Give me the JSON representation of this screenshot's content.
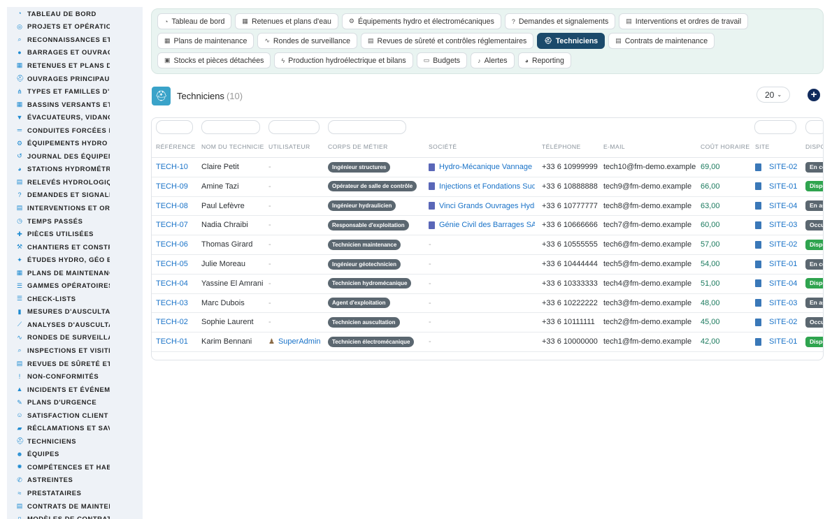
{
  "sidebar": {
    "items": [
      {
        "label": "TABLEAU DE BORD",
        "icon": "dashboard-icon"
      },
      {
        "label": "PROJETS ET OPÉRATIONS",
        "icon": "target-icon"
      },
      {
        "label": "RECONNAISSANCES ET VISITES",
        "icon": "search-icon"
      },
      {
        "label": "BARRAGES ET OUVRAGES",
        "icon": "location-pin-icon"
      },
      {
        "label": "RETENUES ET PLANS D'EAU",
        "icon": "building-icon"
      },
      {
        "label": "OUVRAGES PRINCIPAUX",
        "icon": "hard-hat-icon"
      },
      {
        "label": "TYPES ET FAMILLES D'OUVRAGES",
        "icon": "sitemap-icon"
      },
      {
        "label": "BASSINS VERSANTS ET AFFLUENTS",
        "icon": "grid-icon"
      },
      {
        "label": "ÉVACUATEURS, VIDANGES",
        "icon": "funnel-icon"
      },
      {
        "label": "CONDUITES FORCÉES ET GALERIES",
        "icon": "pipe-icon"
      },
      {
        "label": "ÉQUIPEMENTS HYDRO ET ÉLECTROMÉCANIQUES",
        "icon": "cogs-icon"
      },
      {
        "label": "JOURNAL DES ÉQUIPEMENTS",
        "icon": "history-icon"
      },
      {
        "label": "STATIONS HYDROMÉTRIQUES",
        "icon": "gauge-icon"
      },
      {
        "label": "RELEVÉS HYDROLOGIQUES",
        "icon": "clipboard-icon"
      },
      {
        "label": "DEMANDES ET SIGNALEMENTS",
        "icon": "question-circle-icon"
      },
      {
        "label": "INTERVENTIONS ET ORDRES DE TRAVAIL",
        "icon": "clipboard-check-icon"
      },
      {
        "label": "TEMPS PASSÉS",
        "icon": "clock-icon"
      },
      {
        "label": "PIÈCES UTILISÉES",
        "icon": "puzzle-icon"
      },
      {
        "label": "CHANTIERS ET CONSTRUCTIONS",
        "icon": "hammer-icon"
      },
      {
        "label": "ÉTUDES HYDRO, GÉO ET STRUCTURE",
        "icon": "compass-icon"
      },
      {
        "label": "PLANS DE MAINTENANCE",
        "icon": "calendar-icon"
      },
      {
        "label": "GAMMES OPÉRATOIRES",
        "icon": "tasks-icon"
      },
      {
        "label": "CHECK-LISTS",
        "icon": "list-icon"
      },
      {
        "label": "MESURES D'AUSCULTATION",
        "icon": "ruler-icon"
      },
      {
        "label": "ANALYSES D'AUSCULTATION",
        "icon": "chart-line-icon"
      },
      {
        "label": "RONDES DE SURVEILLANCE",
        "icon": "route-icon"
      },
      {
        "label": "INSPECTIONS ET VISITES",
        "icon": "search-document-icon"
      },
      {
        "label": "REVUES DE SÛRETÉ ET CONTRÔLES",
        "icon": "file-check-icon"
      },
      {
        "label": "NON-CONFORMITÉS",
        "icon": "exclamation-circle-icon"
      },
      {
        "label": "INCIDENTS ET ÉVÉNEMENTS",
        "icon": "warning-icon"
      },
      {
        "label": "PLANS D'URGENCE",
        "icon": "file-signature-icon"
      },
      {
        "label": "SATISFACTION CLIENT",
        "icon": "smile-icon"
      },
      {
        "label": "RÉCLAMATIONS ET SAV",
        "icon": "comment-icon"
      },
      {
        "label": "TECHNICIENS",
        "icon": "hard-hat-icon"
      },
      {
        "label": "ÉQUIPES",
        "icon": "users-icon"
      },
      {
        "label": "COMPÉTENCES ET HABILITATIONS",
        "icon": "certificate-icon"
      },
      {
        "label": "ASTREINTES",
        "icon": "phone-icon"
      },
      {
        "label": "PRESTATAIRES",
        "icon": "handshake-icon"
      },
      {
        "label": "CONTRATS DE MAINTENANCE",
        "icon": "file-contract-icon"
      },
      {
        "label": "MODÈLES DE CONTRATS",
        "icon": "file-icon"
      }
    ]
  },
  "tabs": [
    {
      "label": "Tableau de bord",
      "icon": "dashboard-icon",
      "glyph": "◔",
      "active": false
    },
    {
      "label": "Retenues et plans d'eau",
      "icon": "building-icon",
      "glyph": "▦",
      "active": false
    },
    {
      "label": "Équipements hydro et électromécaniques",
      "icon": "cogs-icon",
      "glyph": "⚙",
      "active": false
    },
    {
      "label": "Demandes et signalements",
      "icon": "question-circle-icon",
      "glyph": "?",
      "active": false
    },
    {
      "label": "Interventions et ordres de travail",
      "icon": "clipboard-check-icon",
      "glyph": "▤",
      "active": false
    },
    {
      "label": "Plans de maintenance",
      "icon": "calendar-icon",
      "glyph": "▦",
      "active": false
    },
    {
      "label": "Rondes de surveillance",
      "icon": "route-icon",
      "glyph": "∿",
      "active": false
    },
    {
      "label": "Revues de sûreté et contrôles réglementaires",
      "icon": "file-check-icon",
      "glyph": "▤",
      "active": false
    },
    {
      "label": "Techniciens",
      "icon": "hard-hat-icon",
      "glyph": "⛑",
      "active": true
    },
    {
      "label": "Contrats de maintenance",
      "icon": "file-contract-icon",
      "glyph": "▤",
      "active": false
    },
    {
      "label": "Stocks et pièces détachées",
      "icon": "boxes-icon",
      "glyph": "▣",
      "active": false
    },
    {
      "label": "Production hydroélectrique et bilans",
      "icon": "bolt-icon",
      "glyph": "ϟ",
      "active": false
    },
    {
      "label": "Budgets",
      "icon": "money-icon",
      "glyph": "▭",
      "active": false
    },
    {
      "label": "Alertes",
      "icon": "bell-icon",
      "glyph": "♪",
      "active": false
    },
    {
      "label": "Reporting",
      "icon": "pie-chart-icon",
      "glyph": "◕",
      "active": false
    }
  ],
  "page": {
    "title": "Techniciens",
    "count": "(10)",
    "per_page": "20"
  },
  "table": {
    "headers": [
      "RÉFÉRENCE",
      "NOM DU TECHNICIEN",
      "UTILISATEUR",
      "CORPS DE MÉTIER",
      "SOCIÉTÉ",
      "TÉLÉPHONE",
      "E-MAIL",
      "COÛT HORAIRE",
      "SITE",
      "DISPONIBILITÉ"
    ],
    "rows": [
      {
        "ref": "TECH-10",
        "name": "Claire Petit",
        "user": "-",
        "metier": "Ingénieur structures",
        "societe": "Hydro-Mécanique Vannage",
        "tel": "+33 6 10999999",
        "email": "tech10@fm-demo.example",
        "cout": "69,00",
        "site": "SITE-02",
        "dispo": "En cours",
        "dispo_color": "#5b6770"
      },
      {
        "ref": "TECH-09",
        "name": "Amine Tazi",
        "user": "-",
        "metier": "Opérateur de salle de contrôle",
        "societe": "Injections et Fondations Sud",
        "tel": "+33 6 10888888",
        "email": "tech9@fm-demo.example",
        "cout": "66,00",
        "site": "SITE-01",
        "dispo": "Disponible",
        "dispo_color": "#2fa44f"
      },
      {
        "ref": "TECH-08",
        "name": "Paul Lefèvre",
        "user": "-",
        "metier": "Ingénieur hydraulicien",
        "societe": "Vinci Grands Ouvrages Hydro",
        "tel": "+33 6 10777777",
        "email": "tech8@fm-demo.example",
        "cout": "63,00",
        "site": "SITE-04",
        "dispo": "En astreinte",
        "dispo_color": "#5b6770"
      },
      {
        "ref": "TECH-07",
        "name": "Nadia Chraibi",
        "user": "-",
        "metier": "Responsable d'exploitation",
        "societe": "Génie Civil des Barrages SA",
        "tel": "+33 6 10666666",
        "email": "tech7@fm-demo.example",
        "cout": "60,00",
        "site": "SITE-03",
        "dispo": "Occupé",
        "dispo_color": "#5b6770"
      },
      {
        "ref": "TECH-06",
        "name": "Thomas Girard",
        "user": "-",
        "metier": "Technicien maintenance",
        "societe": "-",
        "tel": "+33 6 10555555",
        "email": "tech6@fm-demo.example",
        "cout": "57,00",
        "site": "SITE-02",
        "dispo": "Disponible",
        "dispo_color": "#2fa44f"
      },
      {
        "ref": "TECH-05",
        "name": "Julie Moreau",
        "user": "-",
        "metier": "Ingénieur géotechnicien",
        "societe": "-",
        "tel": "+33 6 10444444",
        "email": "tech5@fm-demo.example",
        "cout": "54,00",
        "site": "SITE-01",
        "dispo": "En cours",
        "dispo_color": "#5b6770"
      },
      {
        "ref": "TECH-04",
        "name": "Yassine El Amrani",
        "user": "-",
        "metier": "Technicien hydromécanique",
        "societe": "-",
        "tel": "+33 6 10333333",
        "email": "tech4@fm-demo.example",
        "cout": "51,00",
        "site": "SITE-04",
        "dispo": "Disponible",
        "dispo_color": "#2fa44f"
      },
      {
        "ref": "TECH-03",
        "name": "Marc Dubois",
        "user": "-",
        "metier": "Agent d'exploitation",
        "societe": "-",
        "tel": "+33 6 10222222",
        "email": "tech3@fm-demo.example",
        "cout": "48,00",
        "site": "SITE-03",
        "dispo": "En astreinte",
        "dispo_color": "#5b6770"
      },
      {
        "ref": "TECH-02",
        "name": "Sophie Laurent",
        "user": "-",
        "metier": "Technicien auscultation",
        "societe": "-",
        "tel": "+33 6 10111111",
        "email": "tech2@fm-demo.example",
        "cout": "45,00",
        "site": "SITE-02",
        "dispo": "Occupé",
        "dispo_color": "#5b6770"
      },
      {
        "ref": "TECH-01",
        "name": "Karim Bennani",
        "user": "SuperAdmin",
        "metier": "Technicien électromécanique",
        "societe": "-",
        "tel": "+33 6 10000000",
        "email": "tech1@fm-demo.example",
        "cout": "42,00",
        "site": "SITE-01",
        "dispo": "Disponible",
        "dispo_color": "#2fa44f"
      }
    ]
  }
}
